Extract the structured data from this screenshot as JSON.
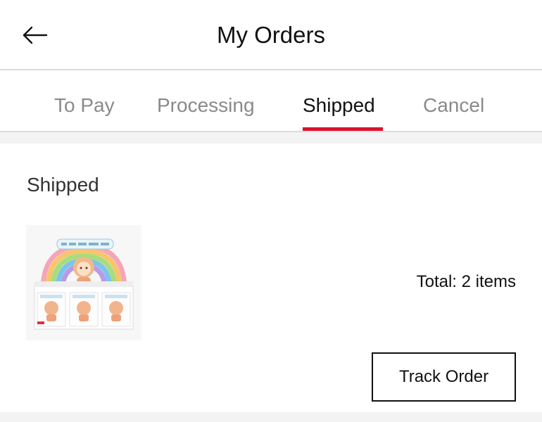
{
  "header": {
    "title": "My Orders",
    "back_icon": "arrow-left-icon"
  },
  "tabs": [
    {
      "label": "To Pay",
      "active": false
    },
    {
      "label": "Processing",
      "active": false
    },
    {
      "label": "Shipped",
      "active": true
    },
    {
      "label": "Cancel",
      "active": false
    }
  ],
  "colors": {
    "accent": "#d9112d",
    "text": "#111111",
    "muted": "#8a8a8a",
    "divider": "#dcdcdc",
    "background_band": "#f3f3f3"
  },
  "order": {
    "status": "Shipped",
    "total_text": "Total: 2 items",
    "track_button_label": "Track Order",
    "product_image": "blind-box-display-image"
  }
}
